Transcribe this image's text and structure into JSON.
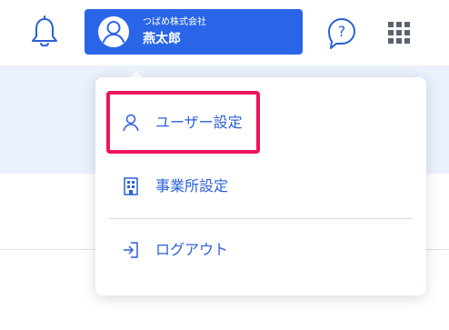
{
  "header": {
    "bell_icon": "bell-icon",
    "user": {
      "company": "つばめ株式会社",
      "name": "燕太郎",
      "avatar_icon": "user-avatar-icon"
    },
    "help_icon": "help-question-icon",
    "apps_icon": "app-grid-icon"
  },
  "menu": {
    "items": [
      {
        "label": "ユーザー設定",
        "icon": "user-icon",
        "highlighted": true
      },
      {
        "label": "事業所設定",
        "icon": "building-icon"
      },
      {
        "label": "ログアウト",
        "icon": "logout-icon"
      }
    ]
  },
  "colors": {
    "primary": "#2a65e8",
    "menu_text": "#2a5fd8",
    "highlight": "#f0145a",
    "banner": "#eaf1fc"
  }
}
